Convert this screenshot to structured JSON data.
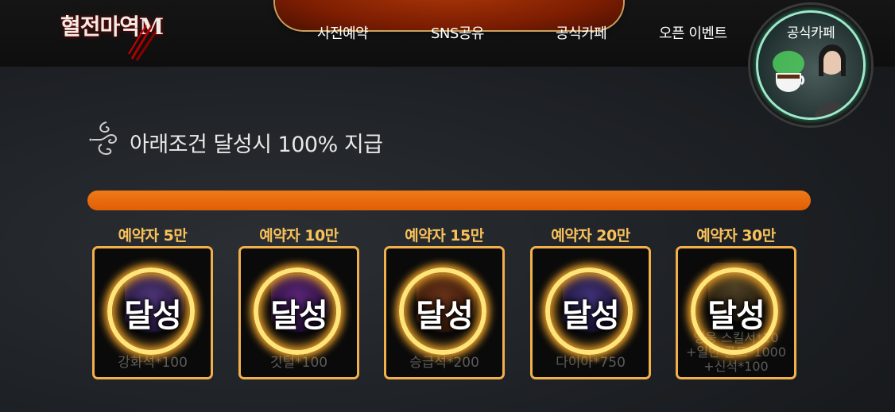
{
  "header": {
    "logo_text": "혈전마역M",
    "nav": [
      {
        "label": "사전예약"
      },
      {
        "label": "SNS공유"
      },
      {
        "label": "공식카페"
      },
      {
        "label": "오픈 이벤트"
      }
    ],
    "cafe_badge_label": "공식카페"
  },
  "section": {
    "title": "아래조건 달성시 100% 지급"
  },
  "progress": {
    "value_percent": 100,
    "color": "#ef6c0f"
  },
  "rewards": [
    {
      "label": "예약자 5만",
      "status": "달성",
      "item": "강화석*100"
    },
    {
      "label": "예약자 10만",
      "status": "달성",
      "item": "깃털*100"
    },
    {
      "label": "예약자 15만",
      "status": "달성",
      "item": "승급석*200"
    },
    {
      "label": "예약자 20만",
      "status": "달성",
      "item": "다이아*750"
    },
    {
      "label": "예약자 30만",
      "status": "달성",
      "item_lines": [
        "영웅 스킬서*10",
        "+일반 골드*1000",
        "+신석*100"
      ]
    }
  ],
  "colors": {
    "accent": "#f2b04a",
    "label": "#f8c15a"
  }
}
